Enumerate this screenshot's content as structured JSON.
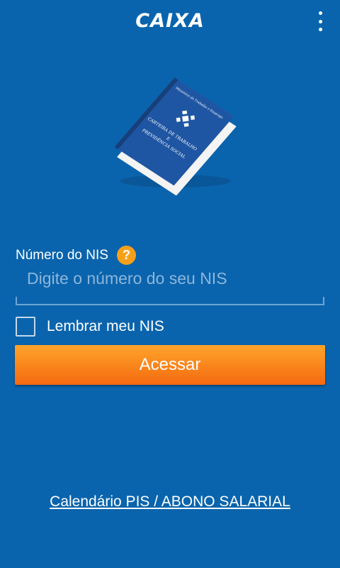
{
  "header": {
    "logo_text": "CAIXA",
    "menu_icon": "more-vert-icon"
  },
  "illustration": {
    "icon": "work-card-booklet-icon",
    "cover_line_1": "CARTEIRA DE TRABALHO",
    "cover_line_2": "E",
    "cover_line_3": "PREVIDÊNCIA SOCIAL",
    "cover_top_text": "Ministério do Trabalho e Emprego"
  },
  "form": {
    "nis_label": "Número do NIS",
    "help_symbol": "?",
    "nis_value": "",
    "nis_placeholder": "Digite o número do seu NIS",
    "remember_label": "Lembrar meu NIS",
    "remember_checked": false,
    "submit_label": "Acessar"
  },
  "footer": {
    "calendar_link": "Calendário PIS / ABONO SALARIAL"
  },
  "colors": {
    "background": "#0a64ad",
    "accent_orange": "#f6a01a",
    "placeholder": "#8cb6db",
    "card_cover": "#1f56a3"
  }
}
